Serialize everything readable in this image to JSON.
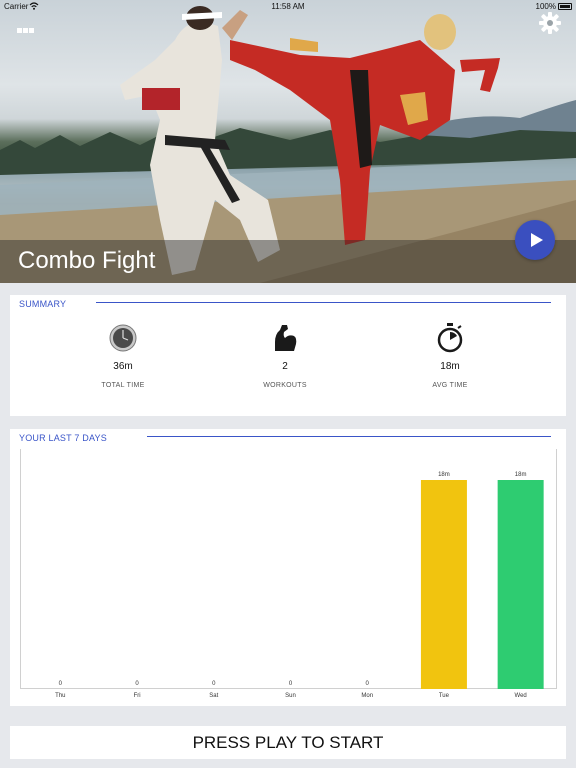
{
  "status_bar": {
    "carrier": "Carrier",
    "time": "11:58 AM",
    "battery": "100%"
  },
  "hero": {
    "title": "Combo Fight"
  },
  "summary": {
    "heading": "SUMMARY",
    "stats": [
      {
        "icon": "clock-icon",
        "value": "36m",
        "label": "TOTAL TIME"
      },
      {
        "icon": "flexed-arm-icon",
        "value": "2",
        "label": "WORKOUTS"
      },
      {
        "icon": "stopwatch-icon",
        "value": "18m",
        "label": "AVG TIME"
      }
    ]
  },
  "last7": {
    "heading": "YOUR LAST 7 DAYS"
  },
  "chart_data": {
    "type": "bar",
    "categories": [
      "Thu",
      "Fri",
      "Sat",
      "Sun",
      "Mon",
      "Tue",
      "Wed"
    ],
    "values": [
      0,
      0,
      0,
      0,
      0,
      18,
      18
    ],
    "value_labels": [
      "0",
      "0",
      "0",
      "0",
      "0",
      "18m",
      "18m"
    ],
    "colors": [
      "#f1c40f",
      "#f1c40f",
      "#f1c40f",
      "#f1c40f",
      "#f1c40f",
      "#f1c40f",
      "#2ecc71"
    ],
    "unit": "m",
    "ylim": [
      0,
      18
    ],
    "grid": false
  },
  "footer": {
    "start_label": "PRESS PLAY TO START"
  },
  "colors": {
    "accent": "#3a55c8",
    "play": "#3a4fbf",
    "bar_yellow": "#f1c40f",
    "bar_green": "#2ecc71"
  }
}
